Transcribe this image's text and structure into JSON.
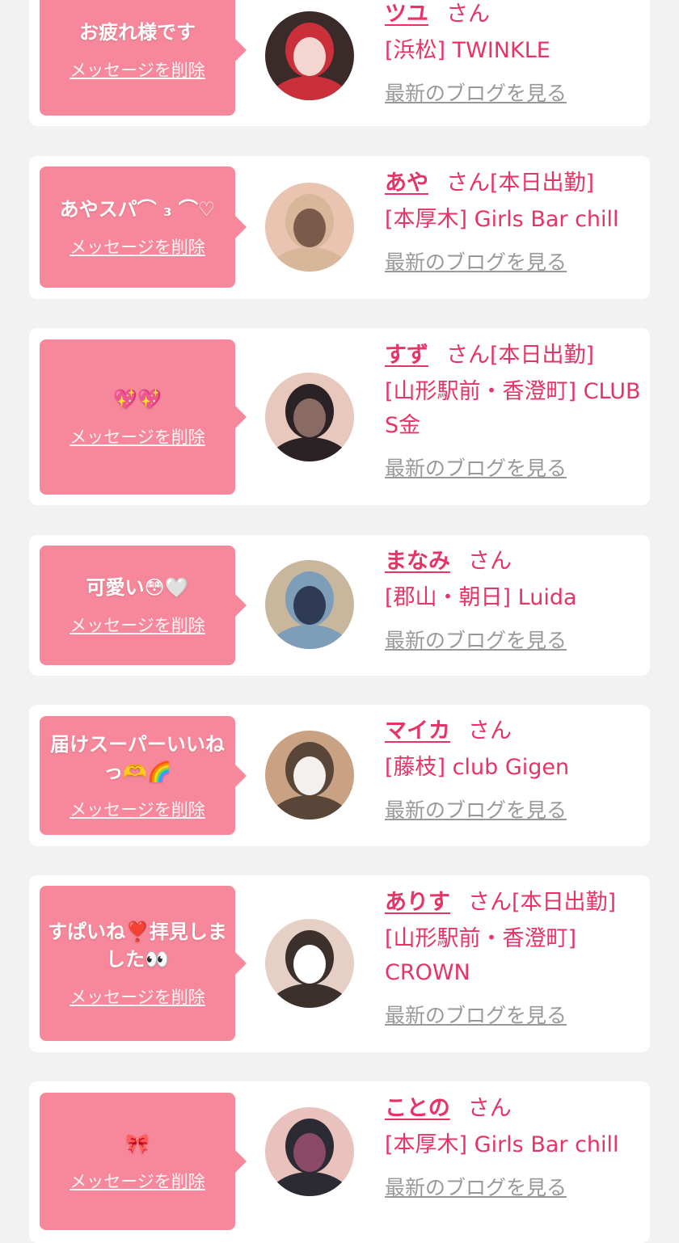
{
  "delete_label": "メッセージを削除",
  "blog_label": "最新のブログを見る",
  "san_label": "さん",
  "colors": {
    "accent": "#e63467",
    "bubble": "#f7879a",
    "background": "#f2f2f2",
    "muted": "#999999"
  },
  "items": [
    {
      "message": "お疲れ様です",
      "name": "ツユ",
      "badge": "",
      "shop": "[浜松] TWINKLE",
      "avatar": "avatar-photo"
    },
    {
      "message": "あやスパ⌒ ₃ ⌒♡",
      "name": "あや",
      "badge": "[本日出勤]",
      "shop": "[本厚木] Girls Bar chill",
      "avatar": "avatar-photo"
    },
    {
      "message": "💖💖",
      "name": "すず",
      "badge": "[本日出勤]",
      "shop": "[山形駅前・香澄町] CLUB S金",
      "avatar": "avatar-photo"
    },
    {
      "message": "可愛い😳🤍",
      "name": "まなみ",
      "badge": "",
      "shop": "[郡山・朝日] Luida",
      "avatar": "avatar-photo"
    },
    {
      "message": "届けスーパーいいねっ🫶🌈",
      "name": "マイカ",
      "badge": "",
      "shop": "[藤枝] club Gigen",
      "avatar": "avatar-photo"
    },
    {
      "message": "すぱいね❣️拝見しました👀",
      "name": "ありす",
      "badge": "[本日出勤]",
      "shop": "[山形駅前・香澄町] CROWN",
      "avatar": "avatar-photo"
    },
    {
      "message": "🎀",
      "name": "ことの",
      "badge": "",
      "shop": "[本厚木] Girls Bar chill",
      "avatar": "avatar-photo"
    }
  ]
}
